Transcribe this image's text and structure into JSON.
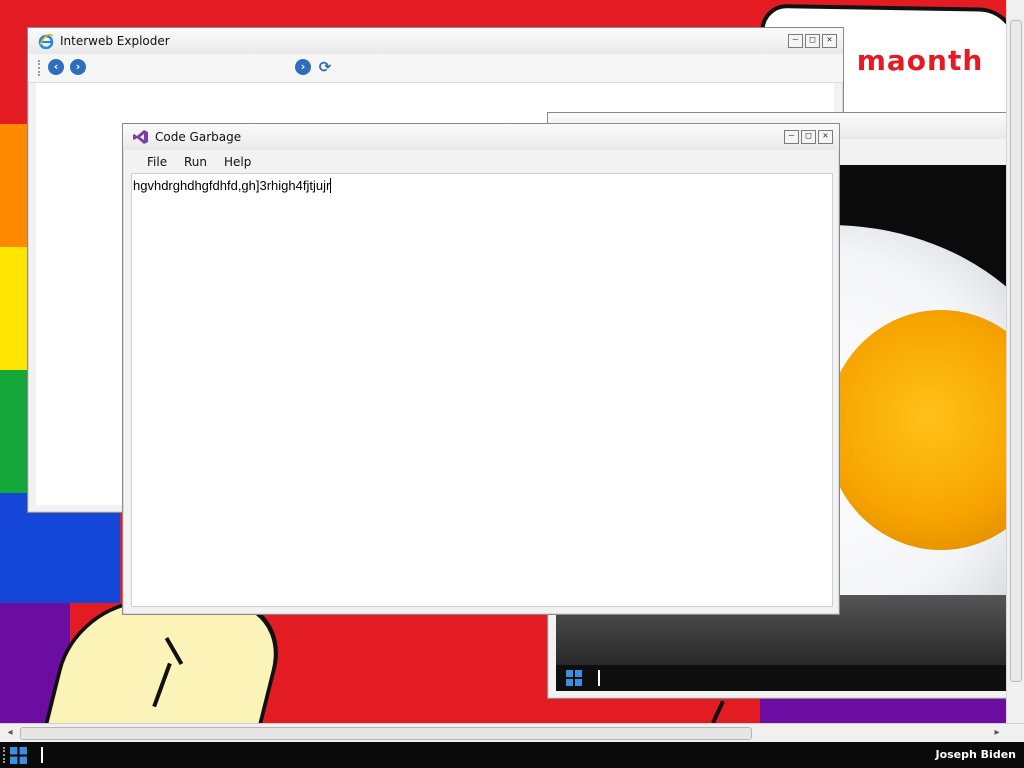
{
  "wallpaper": {
    "speech_text": "e maonth",
    "colors": {
      "background": "#e31b23",
      "rainbow": [
        "#e31b23",
        "#ff8a00",
        "#ffe600",
        "#14a83a",
        "#1446d8",
        "#6a0da0"
      ],
      "speech_text": "#e31b23"
    }
  },
  "windows": {
    "ie": {
      "title": "Interweb Exploder",
      "icon": "ie-icon",
      "buttons": [
        "minimize-icon",
        "maximize-icon",
        "close-icon"
      ],
      "nav": {
        "back_icon": "back-arrow-icon",
        "forward_icon": "forward-arrow-icon",
        "go_icon": "go-arrow-icon",
        "refresh_icon": "refresh-icon"
      }
    },
    "code": {
      "title": "Code Garbage",
      "icon": "visual-studio-icon",
      "menu": [
        "File",
        "Run",
        "Help"
      ],
      "editor_text": "hgvhdrghdhgfdhfd,gh]3rhigh4fjtjujr"
    },
    "viewer": {
      "image": "fried-egg-photo"
    }
  },
  "taskbar": {
    "start_icon": "windows-logo-icon",
    "user": "Joseph Biden"
  },
  "glyphs": {
    "minimize": "–",
    "maximize": "□",
    "close": "✕",
    "back": "‹",
    "forward": "›",
    "go": "›",
    "refresh": "⟳",
    "scroll_left": "◂",
    "scroll_right": "▸"
  }
}
